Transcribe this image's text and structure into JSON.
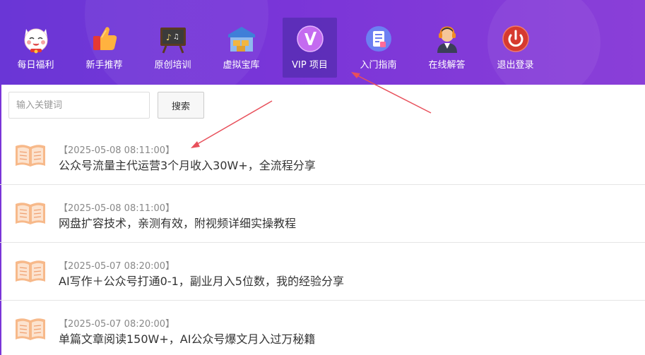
{
  "nav": {
    "items": [
      {
        "label": "每日福利",
        "icon": "lucky-cat-icon"
      },
      {
        "label": "新手推荐",
        "icon": "thumbs-up-icon"
      },
      {
        "label": "原创培训",
        "icon": "chalkboard-icon"
      },
      {
        "label": "虚拟宝库",
        "icon": "warehouse-icon"
      },
      {
        "label": "VIP 项目",
        "icon": "vip-badge-icon"
      },
      {
        "label": "入门指南",
        "icon": "document-icon"
      },
      {
        "label": "在线解答",
        "icon": "support-agent-icon"
      },
      {
        "label": "退出登录",
        "icon": "power-icon"
      }
    ],
    "active_index": 4
  },
  "search": {
    "placeholder": "输入关键词",
    "value": "",
    "button_label": "搜索"
  },
  "articles": [
    {
      "date": "【2025-05-08 08:11:00】",
      "title": "公众号流量主代运营3个月收入30W+，全流程分享"
    },
    {
      "date": "【2025-05-08 08:11:00】",
      "title": "网盘扩容技术，亲测有效，附视频详细实操教程"
    },
    {
      "date": "【2025-05-07 08:20:00】",
      "title": "AI写作＋公众号打通0-1，副业月入5位数，我的经验分享"
    },
    {
      "date": "【2025-05-07 08:20:00】",
      "title": "单篇文章阅读150W+，AI公众号爆文月入过万秘籍"
    }
  ],
  "colors": {
    "nav_gradient_start": "#6a36d6",
    "nav_gradient_end": "#8a3fd8",
    "annotation_arrow": "#e8505b",
    "book_icon": "#f0a070"
  }
}
